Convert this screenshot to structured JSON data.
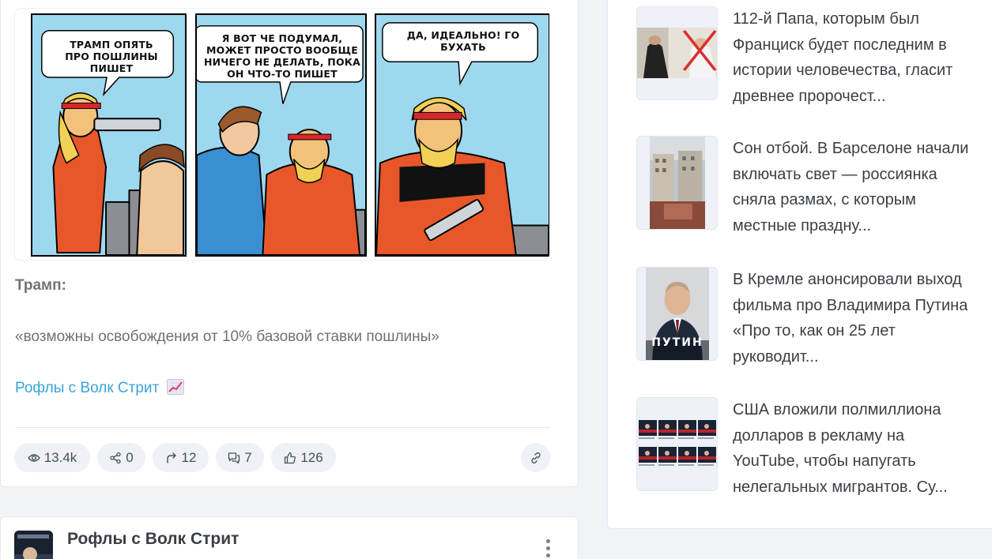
{
  "post": {
    "comic": {
      "panel1_text": "ТРАМП ОПЯТЬ ПРО ПОШЛИНЫ ПИШЕТ",
      "panel2_text": "Я ВОТ ЧЕ ПОДУМАЛ, МОЖЕТ ПРОСТО ВООБЩЕ НИЧЕГО НЕ ДЕЛАТЬ, ПОКА ОН ЧТО-ТО ПИШЕТ",
      "panel3_text": "ДА, ИДЕАЛЬНО! ГО БУХАТЬ"
    },
    "title": "Трамп:",
    "quote": "«возможны освобождения от 10% базовой ставки пошлины»",
    "channel_link": "Рофлы с Волк Стрит",
    "stats": {
      "views": "13.4k",
      "shares": "0",
      "reposts": "12",
      "comments": "7",
      "likes": "126"
    }
  },
  "next_post": {
    "channel_name": "Рофлы с Волк Стрит"
  },
  "sidebar": {
    "news": [
      {
        "text": "112-й Папа, которым был Франциск будет последним в истории человечества, гласит древнее пророчест..."
      },
      {
        "text": "Сон отбой. В Барселоне начали включать свет — россиянка сняла размах, с которым местные праздну..."
      },
      {
        "text": "В Кремле анонсировали выход фильма про Владимира Путина «Про то, как он 25 лет руководит..."
      },
      {
        "text": "США вложили полмиллиона долларов в рекламу на YouTube, чтобы напугать нелегальных мигрантов. Су..."
      }
    ],
    "thumb3_caption": "ПУТИН"
  },
  "colors": {
    "link": "#3aa4d8",
    "stat_bg": "#eef1f6",
    "page_bg": "#f1f3f7"
  }
}
